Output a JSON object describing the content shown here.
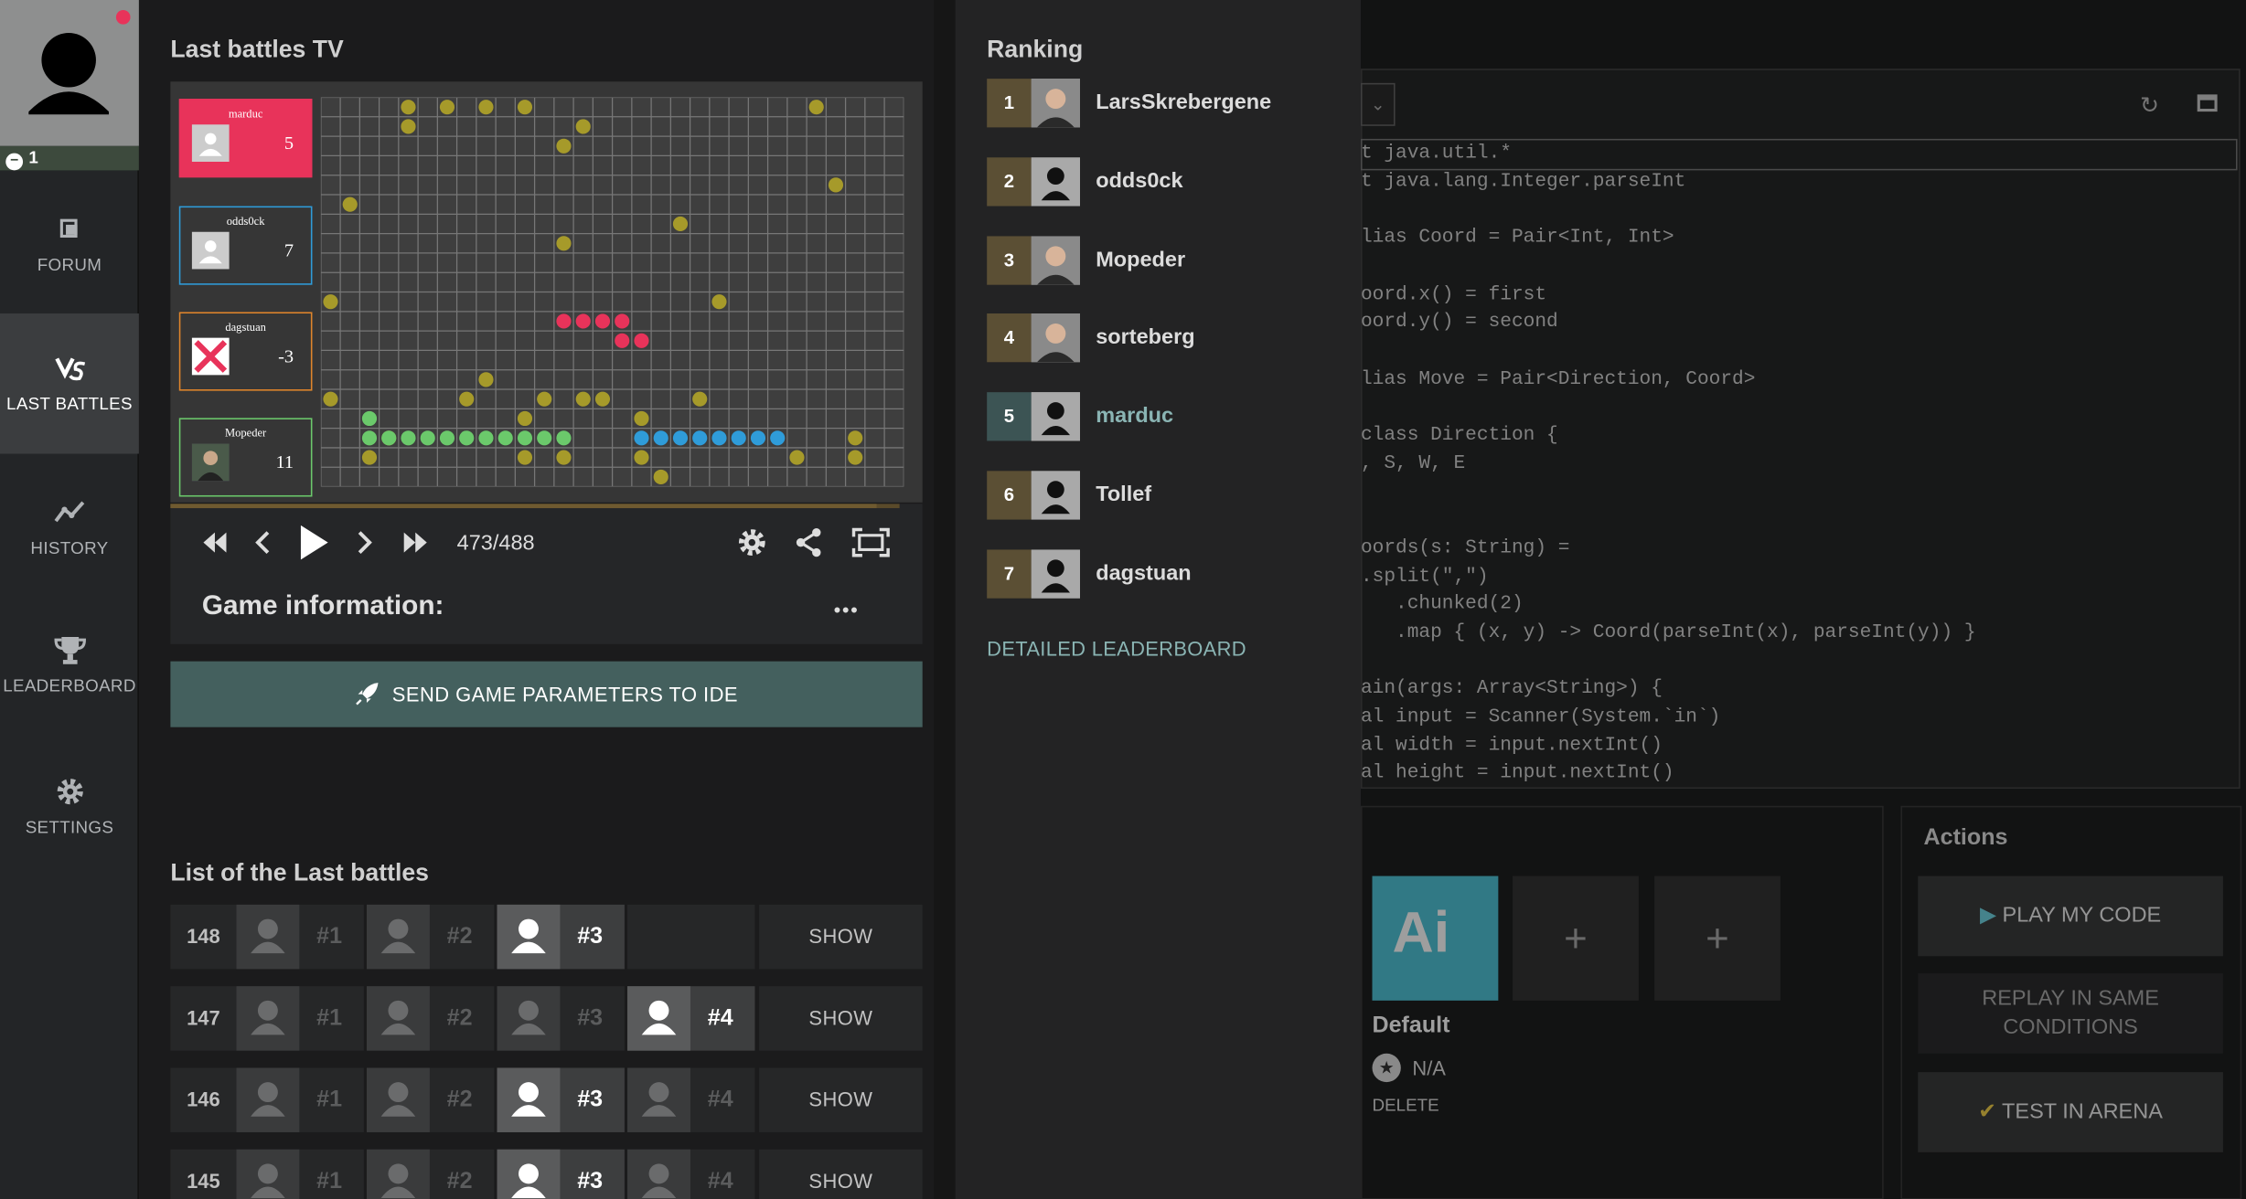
{
  "nav": {
    "level": "1",
    "items": [
      {
        "label": "FORUM",
        "icon": "forum-icon"
      },
      {
        "label": "LAST BATTLES",
        "icon": "versus-icon"
      },
      {
        "label": "HISTORY",
        "icon": "history-icon"
      },
      {
        "label": "LEADERBOARD",
        "icon": "trophy-icon"
      },
      {
        "label": "SETTINGS",
        "icon": "gear-icon"
      }
    ]
  },
  "tv": {
    "title": "Last battles TV",
    "players": [
      {
        "name": "marduc",
        "score": "5",
        "color": "#e8335a"
      },
      {
        "name": "odds0ck",
        "score": "7",
        "color": "#2f9cd9"
      },
      {
        "name": "dagstuan",
        "score": "-3",
        "color": "#e0852b"
      },
      {
        "name": "Mopeder",
        "score": "11",
        "color": "#6bc96b"
      }
    ],
    "frame": "473/488",
    "progress": 0.969,
    "game_info_label": "Game information:",
    "more_label": "•••",
    "send_label": "SEND GAME PARAMETERS TO IDE"
  },
  "battles": {
    "title": "List of the Last battles",
    "show_label": "SHOW",
    "rows": [
      {
        "id": "148",
        "slots": [
          "#1",
          "#2",
          "#3",
          ""
        ],
        "me": 2
      },
      {
        "id": "147",
        "slots": [
          "#1",
          "#2",
          "#3",
          "#4"
        ],
        "me": 3
      },
      {
        "id": "146",
        "slots": [
          "#1",
          "#2",
          "#3",
          "#4"
        ],
        "me": 2
      },
      {
        "id": "145",
        "slots": [
          "#1",
          "#2",
          "#3",
          "#4"
        ],
        "me": 2
      }
    ]
  },
  "ranking": {
    "title": "Ranking",
    "rows": [
      {
        "rank": "1",
        "name": "LarsSkrebergene"
      },
      {
        "rank": "2",
        "name": "odds0ck"
      },
      {
        "rank": "3",
        "name": "Mopeder"
      },
      {
        "rank": "4",
        "name": "sorteberg"
      },
      {
        "rank": "5",
        "name": "marduc"
      },
      {
        "rank": "6",
        "name": "Tollef"
      },
      {
        "rank": "7",
        "name": "dagstuan"
      }
    ],
    "leaderboard_link": "DETAILED LEADERBOARD"
  },
  "ide": {
    "code_lines": [
      "t java.util.*",
      "t java.lang.Integer.parseInt",
      "",
      "lias Coord = Pair<Int, Int>",
      "",
      "oord.x() = first",
      "oord.y() = second",
      "",
      "lias Move = Pair<Direction, Coord>",
      "",
      "class Direction {",
      ", S, W, E",
      "",
      "",
      "oords(s: String) =",
      ".split(\",\")",
      "   .chunked(2)",
      "   .map { (x, y) -> Coord(parseInt(x), parseInt(y)) }",
      "",
      "ain(args: Array<String>) {",
      "al input = Scanner(System.`in`)",
      "al width = input.nextInt()",
      "al height = input.nextInt()"
    ],
    "ai_label": "Ai",
    "ai_name": "Default",
    "ai_rating": "N/A",
    "delete_label": "DELETE",
    "add_label": "+",
    "actions_title": "Actions",
    "play_label": "PLAY MY CODE",
    "replay_label": "REPLAY IN SAME CONDITIONS",
    "test_label": "TEST IN ARENA"
  }
}
